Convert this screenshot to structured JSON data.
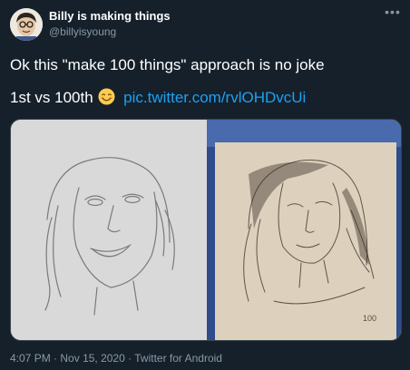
{
  "tweet": {
    "display_name": "Billy is making things",
    "handle": "@billyisyoung",
    "more_icon": "more-horizontal-icon",
    "text_line1": "Ok this \"make 100 things\" approach is no joke",
    "text_line2_prefix": "1st vs 100th",
    "emoji": "smiling-face-emoji",
    "link": "pic.twitter.com/rvlOHDvcUi",
    "media": {
      "left_caption": "",
      "right_label": "100"
    },
    "meta": {
      "time": "4:07 PM",
      "date": "Nov 15, 2020",
      "source": "Twitter for Android",
      "separator": "·"
    }
  },
  "colors": {
    "background": "#15202b",
    "text": "#ffffff",
    "secondary": "#8899a6",
    "link": "#1da1f2"
  }
}
